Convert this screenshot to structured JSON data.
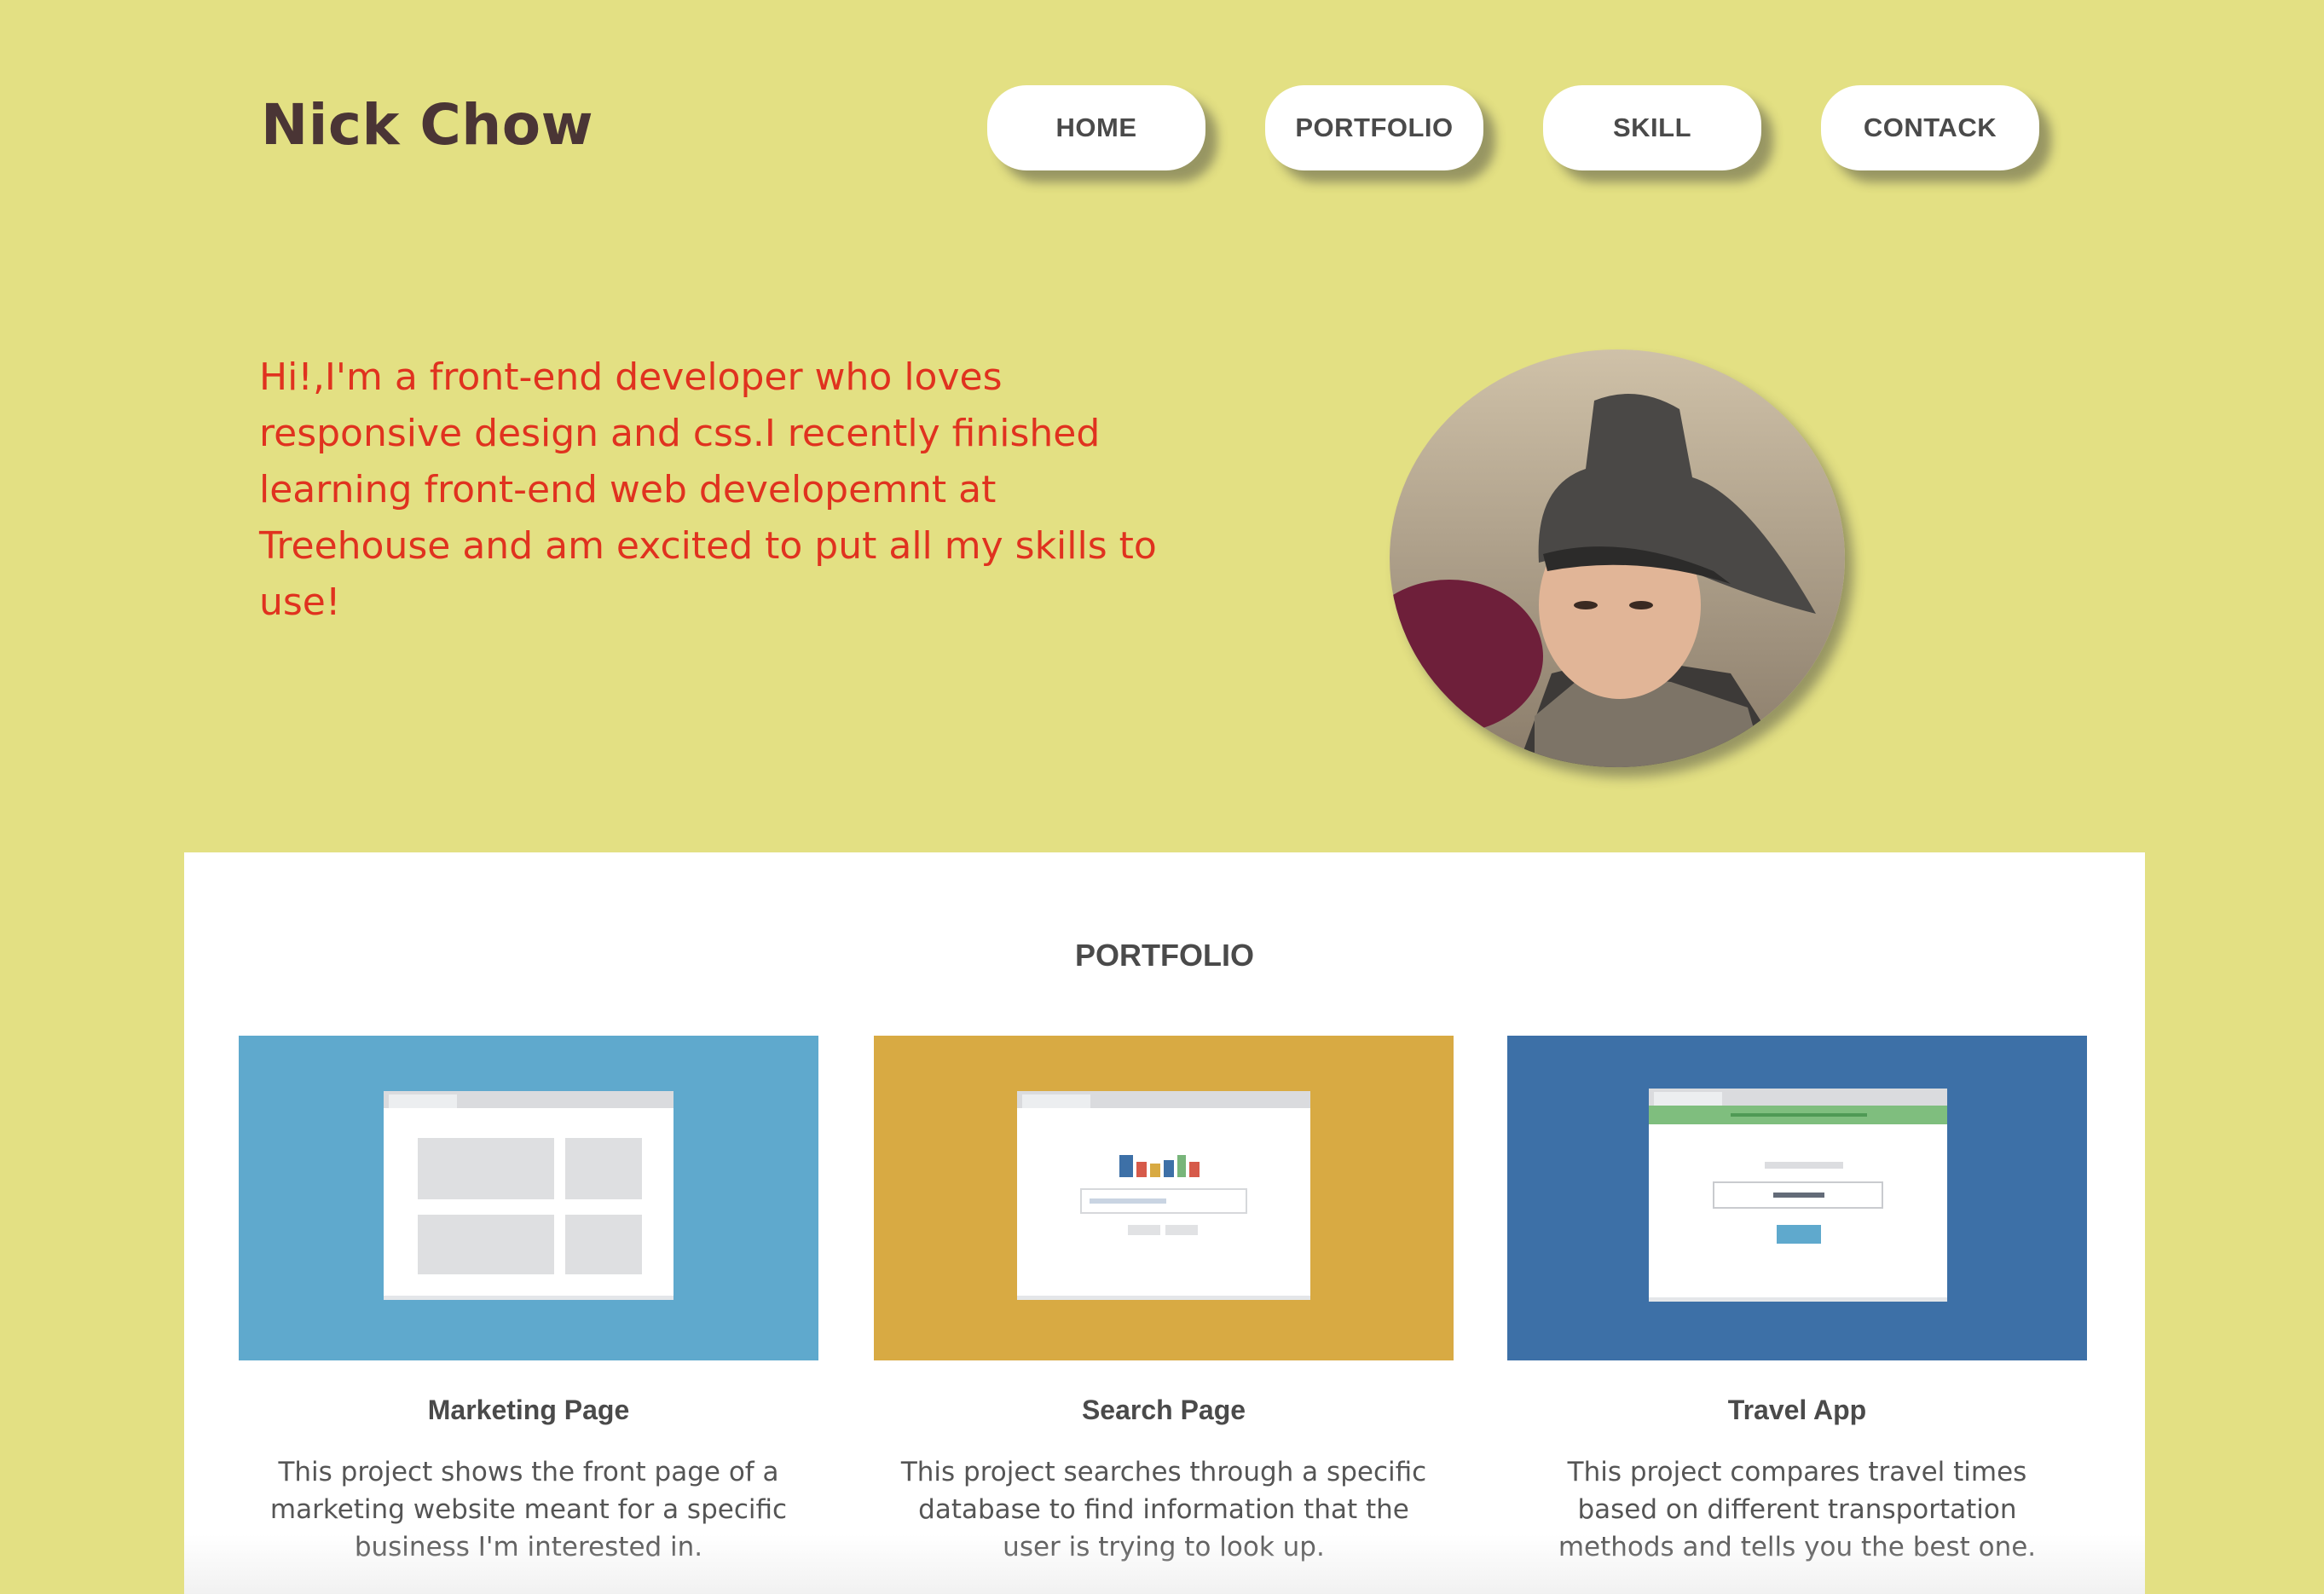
{
  "header": {
    "name": "Nick Chow",
    "nav": [
      {
        "label": "HOME"
      },
      {
        "label": "PORTFOLIO"
      },
      {
        "label": "SKILL"
      },
      {
        "label": "CONTACK"
      }
    ]
  },
  "hero": {
    "intro": "Hi!,I'm a front-end developer who loves responsive design and css.I recently finished learning front-end web developemnt at Treehouse and am excited to put all my skills to use!"
  },
  "portfolio": {
    "title": "PORTFOLIO",
    "projects": [
      {
        "title": "Marketing Page",
        "description": "This project shows the front page of a marketing website meant for a specific business I'm interested in.",
        "color": "#5fa9cd"
      },
      {
        "title": "Search Page",
        "description": "This project searches through a specific database to find information that the user is trying to look up.",
        "color": "#d8aa43"
      },
      {
        "title": "Travel App",
        "description": "This project compares travel times based on different transportation methods and tells you the best one.",
        "color": "#3d70a7"
      }
    ]
  },
  "colors": {
    "background": "#e3e083",
    "accent_text": "#e0321f",
    "brand_text": "#4a3535"
  }
}
